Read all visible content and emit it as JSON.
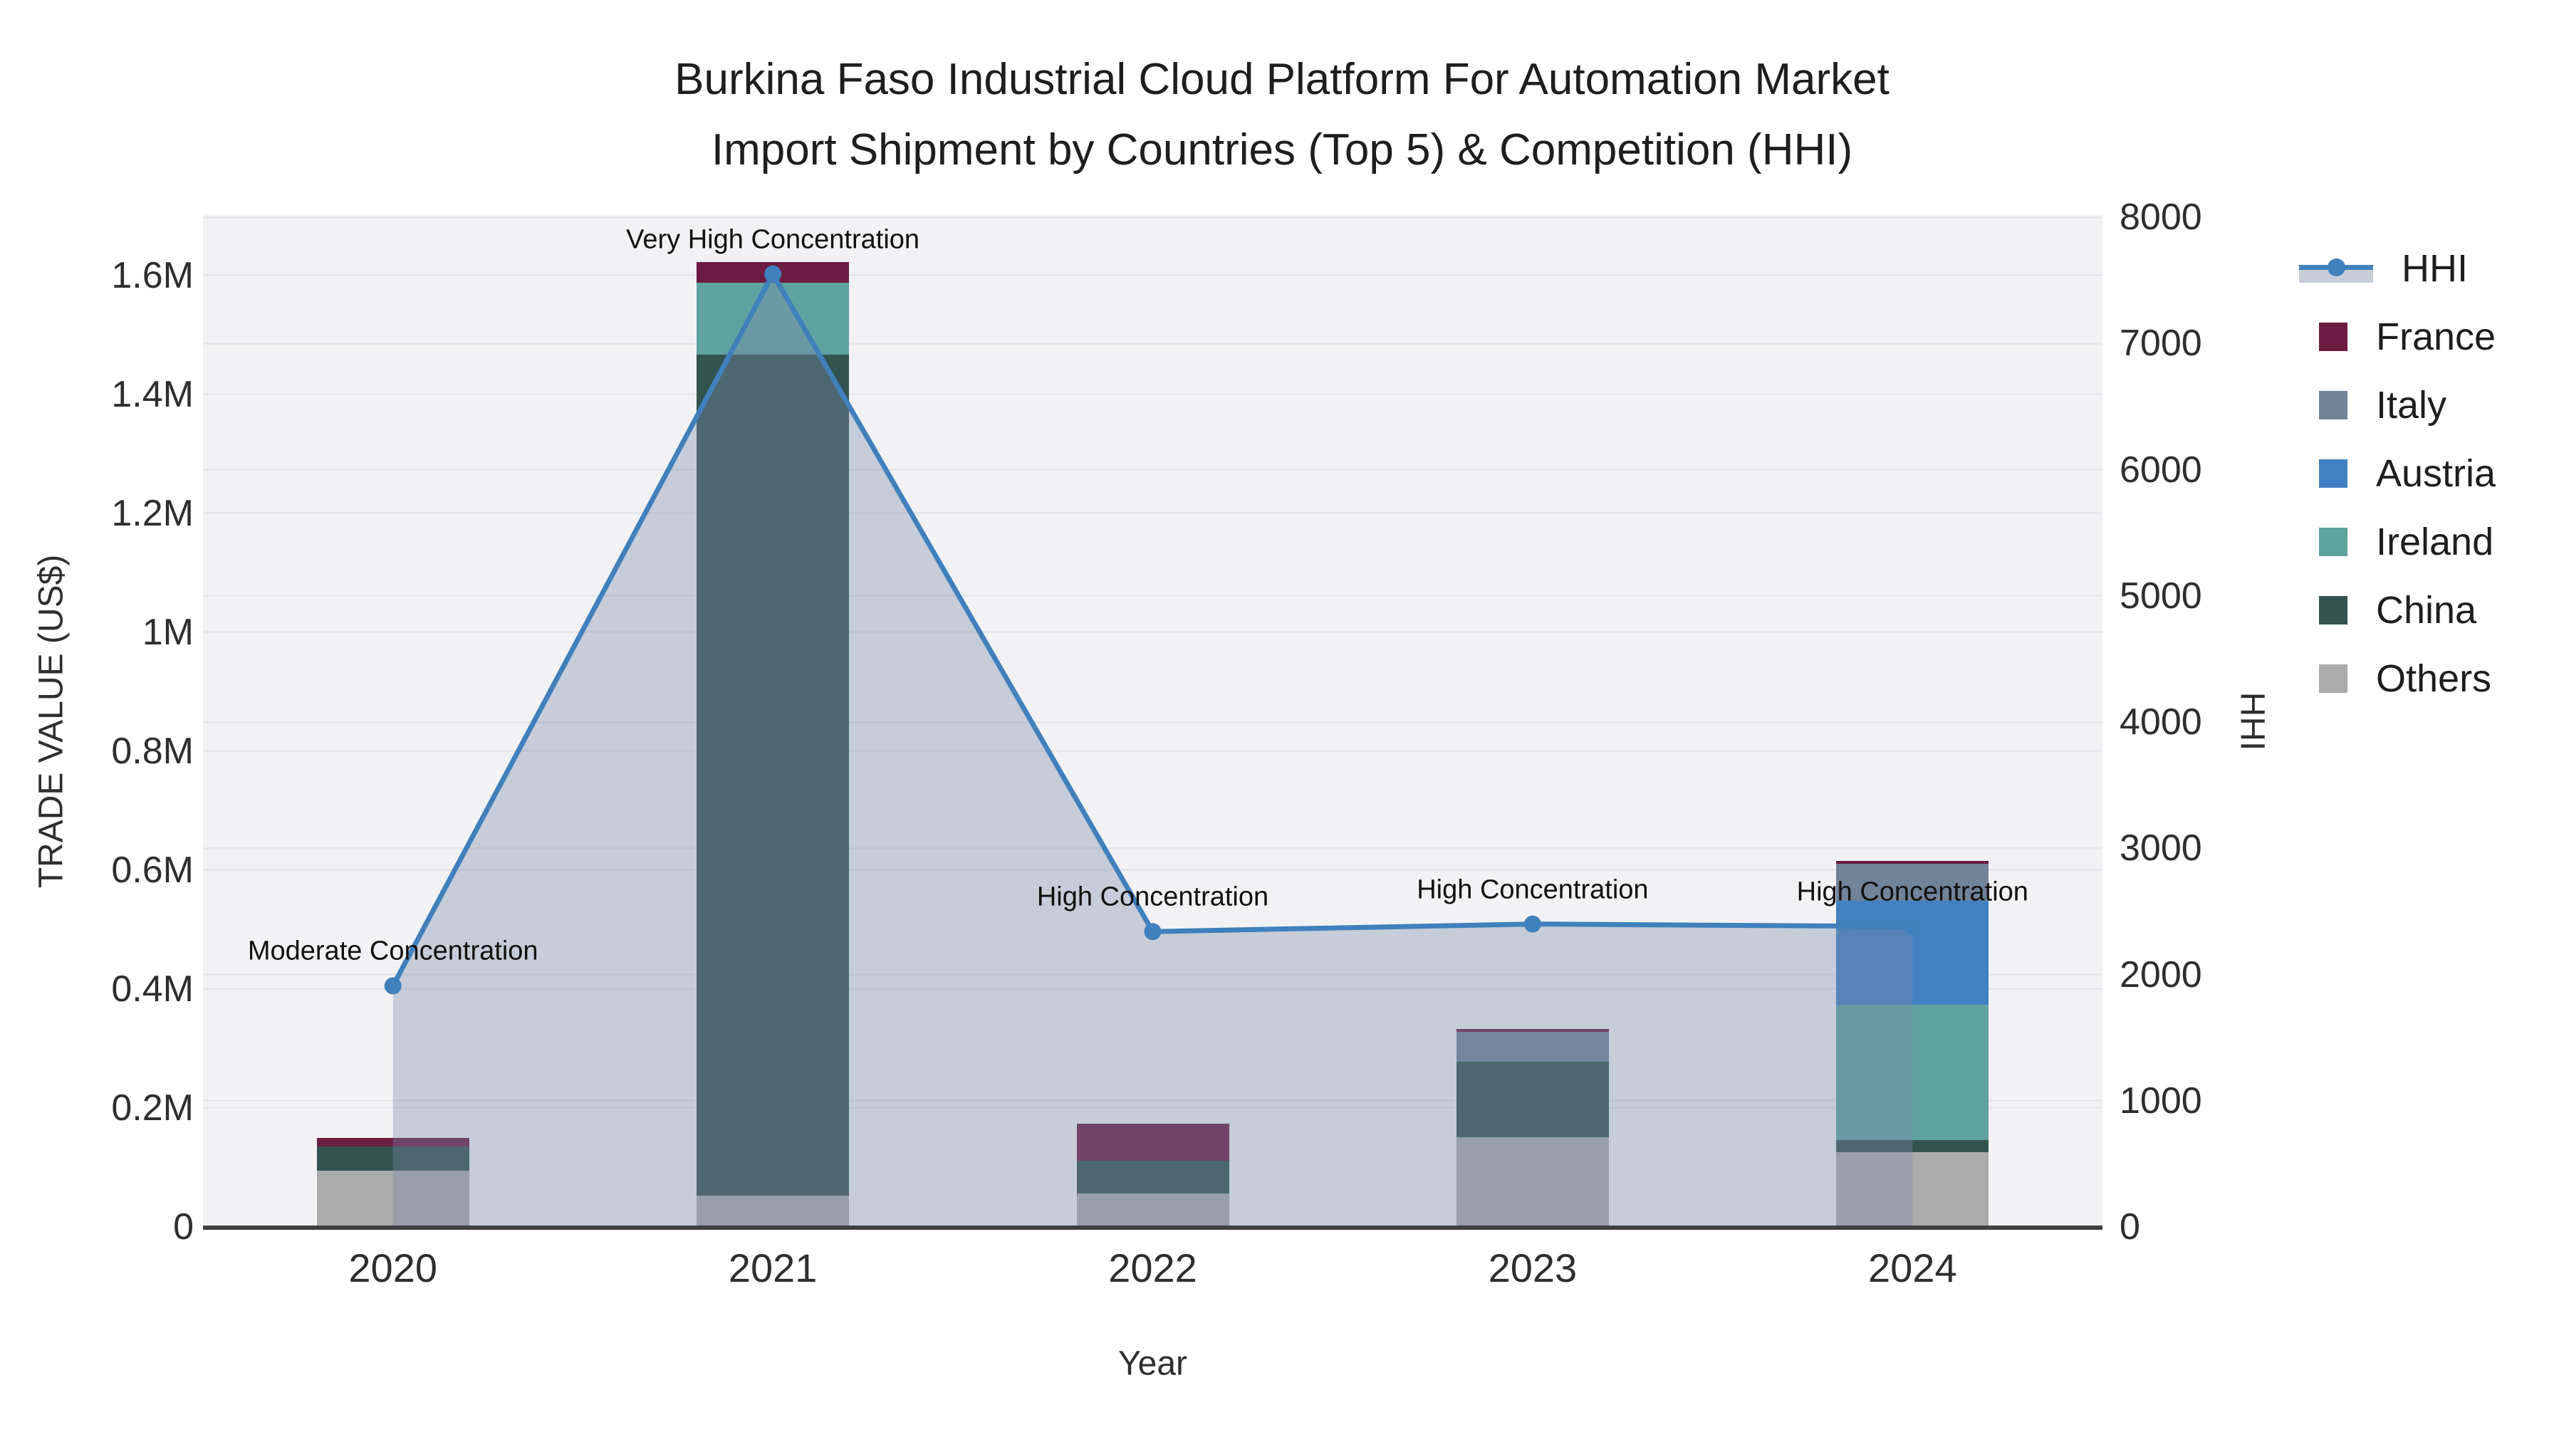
{
  "title": {
    "line1": "Burkina Faso Industrial Cloud Platform For Automation Market",
    "line2": "Import Shipment by Countries (Top 5) & Competition (HHI)"
  },
  "legend": {
    "items": [
      {
        "id": "hhi",
        "label": "HHI",
        "type": "line",
        "color": "#4080bd"
      },
      {
        "id": "france",
        "label": "France",
        "type": "swatch",
        "color": "#6b1c40"
      },
      {
        "id": "italy",
        "label": "Italy",
        "type": "swatch",
        "color": "#718399"
      },
      {
        "id": "austria",
        "label": "Austria",
        "type": "swatch",
        "color": "#4181c2"
      },
      {
        "id": "ireland",
        "label": "Ireland",
        "type": "swatch",
        "color": "#5fa2a0"
      },
      {
        "id": "china",
        "label": "China",
        "type": "swatch",
        "color": "#335350"
      },
      {
        "id": "others",
        "label": "Others",
        "type": "swatch",
        "color": "#ababab"
      }
    ]
  },
  "chart_data": {
    "type": "bar",
    "subtype": "stacked-bars-with-line",
    "categories": [
      "2020",
      "2021",
      "2022",
      "2023",
      "2024"
    ],
    "bar_series": [
      {
        "name": "Others",
        "color": "#ababab",
        "values": [
          95000,
          53000,
          56000,
          151000,
          126000
        ]
      },
      {
        "name": "China",
        "color": "#335350",
        "values": [
          40000,
          1413000,
          55000,
          127000,
          20000
        ]
      },
      {
        "name": "Ireland",
        "color": "#5fa2a0",
        "values": [
          0,
          121000,
          0,
          0,
          227000
        ]
      },
      {
        "name": "Austria",
        "color": "#4181c2",
        "values": [
          0,
          0,
          0,
          0,
          175000
        ]
      },
      {
        "name": "Italy",
        "color": "#718399",
        "values": [
          0,
          0,
          0,
          50000,
          63000
        ]
      },
      {
        "name": "France",
        "color": "#6b1c40",
        "values": [
          15000,
          35000,
          62000,
          5000,
          4000
        ]
      }
    ],
    "line_series": {
      "name": "HHI",
      "color": "#4080bd",
      "fill": "rgba(122,138,167,0.37)",
      "values": [
        1910,
        7550,
        2340,
        2400,
        2380
      ]
    },
    "annotations": [
      {
        "category": "2020",
        "text": "Moderate Concentration"
      },
      {
        "category": "2021",
        "text": "Very High Concentration"
      },
      {
        "category": "2022",
        "text": "High Concentration"
      },
      {
        "category": "2023",
        "text": "High Concentration"
      },
      {
        "category": "2024",
        "text": "High Concentration"
      }
    ],
    "left_axis": {
      "title": "TRADE VALUE (US$)",
      "min": 0,
      "max": 1600000,
      "tick_labels": [
        "0",
        "0.2M",
        "0.4M",
        "0.6M",
        "0.8M",
        "1M",
        "1.2M",
        "1.4M",
        "1.6M"
      ]
    },
    "right_axis": {
      "title": "HHI",
      "min": 0,
      "max": 8000,
      "tick_labels": [
        "0",
        "1000",
        "2000",
        "3000",
        "4000",
        "5000",
        "6000",
        "7000",
        "8000"
      ]
    },
    "x_axis": {
      "title": "Year"
    },
    "legend_position": "right",
    "grid": true
  }
}
